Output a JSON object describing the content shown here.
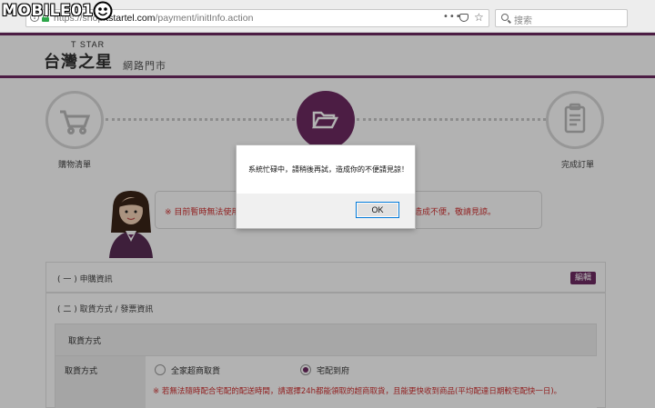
{
  "browser": {
    "url_prefix": "https://shop.",
    "url_host": "tstartel.com",
    "url_path": "/payment/initInfo.action",
    "more_glyph": "•••",
    "search_placeholder": "搜索"
  },
  "watermark": {
    "text": "MOBILE01"
  },
  "site": {
    "logo_small": "T STAR",
    "logo_main": "台灣之星",
    "logo_sub": "網路門市"
  },
  "steps": [
    {
      "label": "購物清單",
      "icon": "cart-icon"
    },
    {
      "label": "",
      "icon": "folder-open-icon"
    },
    {
      "label": "完成訂單",
      "icon": "clipboard-icon"
    }
  ],
  "notice": {
    "text_left": "※ 目前暫時無法使用",
    "text_right": "造成不便，敬請見諒。"
  },
  "sections": {
    "apply_info": "( 一 ) 申購資訊",
    "edit_button": "編輯",
    "pickup_invoice": "( 二 ) 取貨方式 / 發票資訊",
    "pickup_header": "取貨方式",
    "pickup_row_label": "取貨方式",
    "options": [
      {
        "label": "全家超商取貨",
        "selected": false
      },
      {
        "label": "宅配到府",
        "selected": true
      }
    ],
    "warning": "※ 若無法隨時配合宅配的配送時間，請選擇24h都能領取的超商取貨，且能更快收到商品(平均配達日期較宅配快一日)。"
  },
  "dialog": {
    "message": "系統忙碌中，請稍後再試，造成你的不便請見諒！",
    "ok_label": "OK"
  },
  "colors": {
    "brand": "#6d2a62",
    "warning": "#d03030"
  }
}
